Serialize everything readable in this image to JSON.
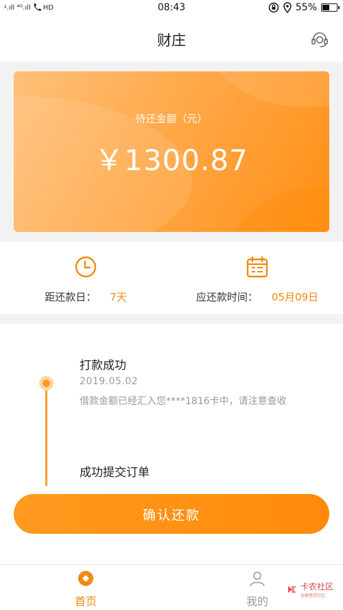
{
  "status_bar": {
    "left": "ᵡ.ıll ⁴ᴳ.ıll",
    "left_badge": "HD",
    "time": "08:43",
    "battery": "55%",
    "battery_level": 0.55
  },
  "header": {
    "title": "财庄"
  },
  "amount_card": {
    "label": "待还金额（元）",
    "value": "￥1300.87"
  },
  "due_info": {
    "days_label": "距还款日：",
    "days_value": "7天",
    "date_label": "应还款时间：",
    "date_value": "05月09日"
  },
  "timeline": {
    "steps": [
      {
        "title": "打款成功",
        "date": "2019.05.02",
        "desc": "借款金额已经汇入您****1816卡中，请注意查收"
      },
      {
        "title": "成功提交订单"
      }
    ]
  },
  "confirm_button": {
    "label": "确认还款"
  },
  "tabbar": {
    "tabs": [
      {
        "label": "首页",
        "icon": "home-diamond-icon",
        "active": true
      },
      {
        "label": "我的",
        "icon": "person-icon",
        "active": false
      }
    ]
  },
  "watermark": {
    "text": "卡农社区",
    "sub": "金融借贷社区"
  },
  "colors": {
    "accent": "#ff9a24",
    "accent_text": "#f08a12"
  }
}
